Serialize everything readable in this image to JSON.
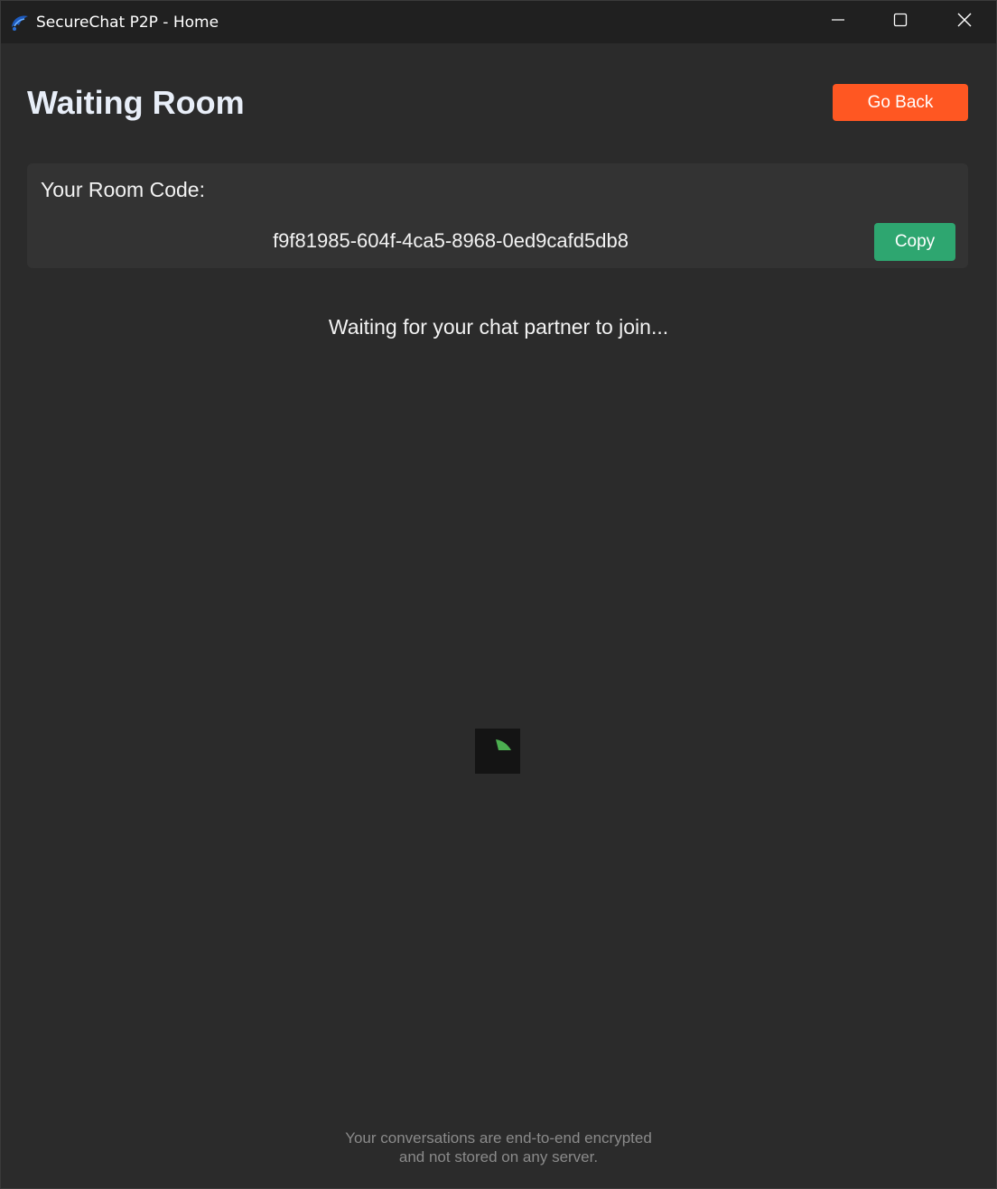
{
  "window": {
    "title": "SecureChat P2P - Home",
    "icons": {
      "app": "app-logo-icon",
      "minimize": "minimize-icon",
      "maximize": "maximize-icon",
      "close": "close-icon"
    }
  },
  "header": {
    "title": "Waiting Room",
    "go_back_label": "Go Back"
  },
  "room": {
    "label": "Your Room Code:",
    "code": "f9f81985-604f-4ca5-8968-0ed9cafd5db8",
    "copy_label": "Copy"
  },
  "status": {
    "message": "Waiting for your chat partner to join...",
    "spinner_icon": "loading-spinner-icon"
  },
  "footer": {
    "line1": "Your conversations are end-to-end encrypted",
    "line2": "and not stored on any server."
  },
  "colors": {
    "background": "#2b2b2b",
    "titlebar": "#202020",
    "go_back": "#ff5722",
    "copy": "#2ea670",
    "spinner": "#4caf50"
  }
}
